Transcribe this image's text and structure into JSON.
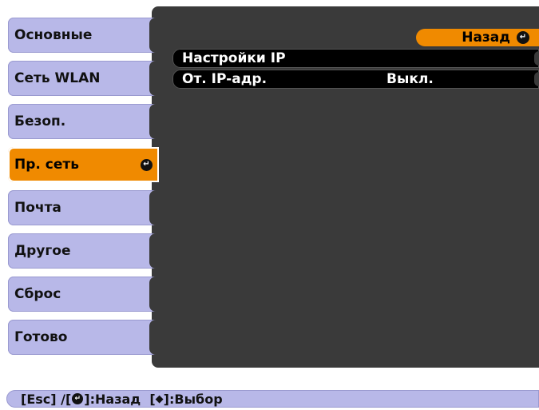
{
  "sidebar": {
    "items": [
      {
        "label": "Основные"
      },
      {
        "label": "Сеть WLAN"
      },
      {
        "label": "Безоп."
      },
      {
        "label": "Пр. сеть"
      },
      {
        "label": "Почта"
      },
      {
        "label": "Другое"
      },
      {
        "label": "Сброс"
      },
      {
        "label": "Готово"
      }
    ],
    "active_index": 3
  },
  "header": {
    "back_label": "Назад"
  },
  "settings": {
    "rows": [
      {
        "label": "Настройки IP",
        "value": ""
      },
      {
        "label": "От. IP-адр.",
        "value": "Выкл."
      }
    ]
  },
  "status_bar": {
    "part1": "[Esc] /[",
    "part2": "]:Назад  [",
    "part3": "]:Выбор"
  },
  "icons": {
    "enter": "enter-icon",
    "up_down": "up-down-arrows-icon"
  },
  "colors": {
    "panel": "#3a3a3a",
    "sidebar_item": "#b8b8e8",
    "accent": "#f08a00",
    "row": "#000000"
  }
}
